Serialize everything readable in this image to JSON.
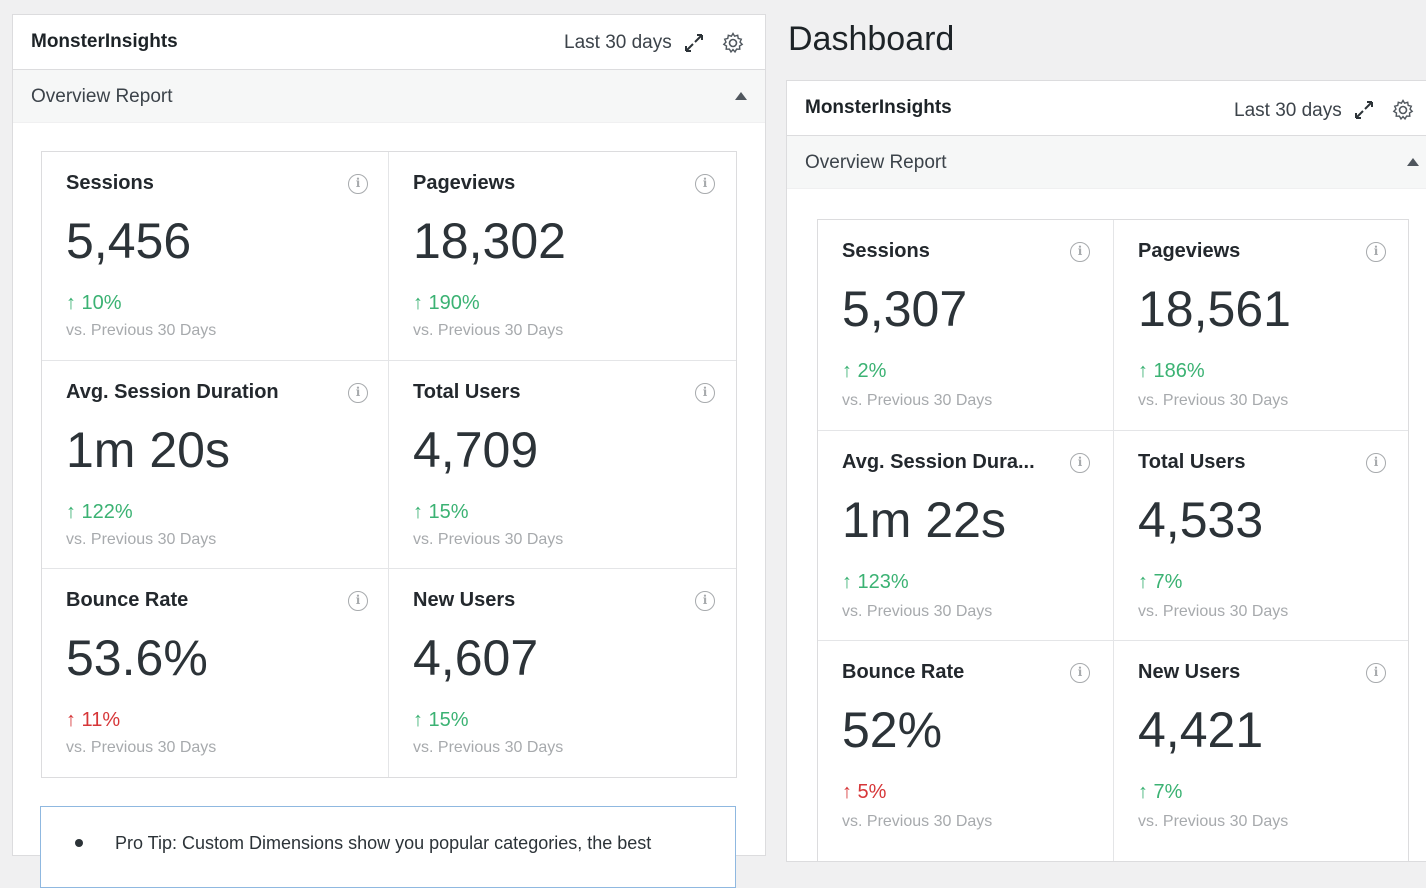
{
  "page": {
    "heading": "Dashboard"
  },
  "left": {
    "brand": "MonsterInsights",
    "range": "Last 30 days",
    "report_title": "Overview Report",
    "metrics": [
      {
        "label": "Sessions",
        "value": "5,456",
        "change": "↑ 10%",
        "trend": "good",
        "note": "vs. Previous 30 Days"
      },
      {
        "label": "Pageviews",
        "value": "18,302",
        "change": "↑ 190%",
        "trend": "good",
        "note": "vs. Previous 30 Days"
      },
      {
        "label": "Avg. Session Duration",
        "value": "1m 20s",
        "change": "↑ 122%",
        "trend": "good",
        "note": "vs. Previous 30 Days"
      },
      {
        "label": "Total Users",
        "value": "4,709",
        "change": "↑ 15%",
        "trend": "good",
        "note": "vs. Previous 30 Days"
      },
      {
        "label": "Bounce Rate",
        "value": "53.6%",
        "change": "↑ 11%",
        "trend": "bad",
        "note": "vs. Previous 30 Days"
      },
      {
        "label": "New Users",
        "value": "4,607",
        "change": "↑ 15%",
        "trend": "good",
        "note": "vs. Previous 30 Days"
      }
    ],
    "protip": "Pro Tip: Custom Dimensions show you popular categories, the best"
  },
  "right": {
    "brand": "MonsterInsights",
    "range": "Last 30 days",
    "report_title": "Overview Report",
    "metrics": [
      {
        "label": "Sessions",
        "value": "5,307",
        "change": "↑ 2%",
        "trend": "good",
        "note": "vs. Previous 30 Days"
      },
      {
        "label": "Pageviews",
        "value": "18,561",
        "change": "↑ 186%",
        "trend": "good",
        "note": "vs. Previous 30 Days"
      },
      {
        "label": "Avg. Session Dura...",
        "value": "1m 22s",
        "change": "↑ 123%",
        "trend": "good",
        "note": "vs. Previous 30 Days"
      },
      {
        "label": "Total Users",
        "value": "4,533",
        "change": "↑ 7%",
        "trend": "good",
        "note": "vs. Previous 30 Days"
      },
      {
        "label": "Bounce Rate",
        "value": "52%",
        "change": "↑ 5%",
        "trend": "bad",
        "note": "vs. Previous 30 Days"
      },
      {
        "label": "New Users",
        "value": "4,421",
        "change": "↑ 7%",
        "trend": "good",
        "note": "vs. Previous 30 Days"
      }
    ]
  },
  "colors": {
    "positive": "#3bb273",
    "negative": "#d63638",
    "muted": "#a7aaad"
  },
  "icons": {
    "expand": "expand-icon",
    "settings": "gear-icon",
    "info": "info-icon",
    "collapse": "caret-up-icon"
  }
}
